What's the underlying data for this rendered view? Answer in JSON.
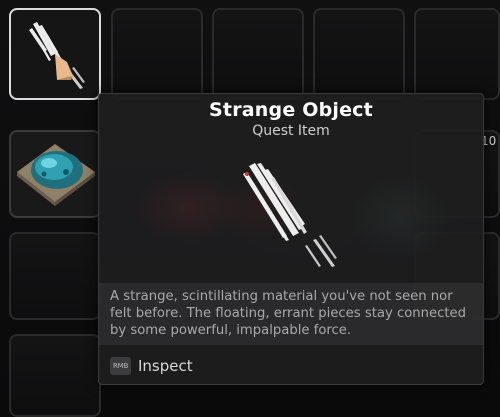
{
  "tooltip": {
    "title": "Strange Object",
    "category": "Quest Item",
    "description": "A strange, scintillating material you've not seen nor felt before. The floating, errant pieces stay connected by some powerful, impalpable force.",
    "action": {
      "key": "RMB",
      "label": "Inspect"
    }
  },
  "inventory": {
    "selected_item": "Strange Object",
    "side_count": "10",
    "slots": [
      {
        "item": "strange-object-icon",
        "selected": true
      },
      {
        "item": "blue-ore-icon",
        "selected": false
      }
    ]
  },
  "colors": {
    "selected_border": "#dcdcdc",
    "panel_bg": "#1e1e1f",
    "desc_text": "#a9a9a9"
  }
}
